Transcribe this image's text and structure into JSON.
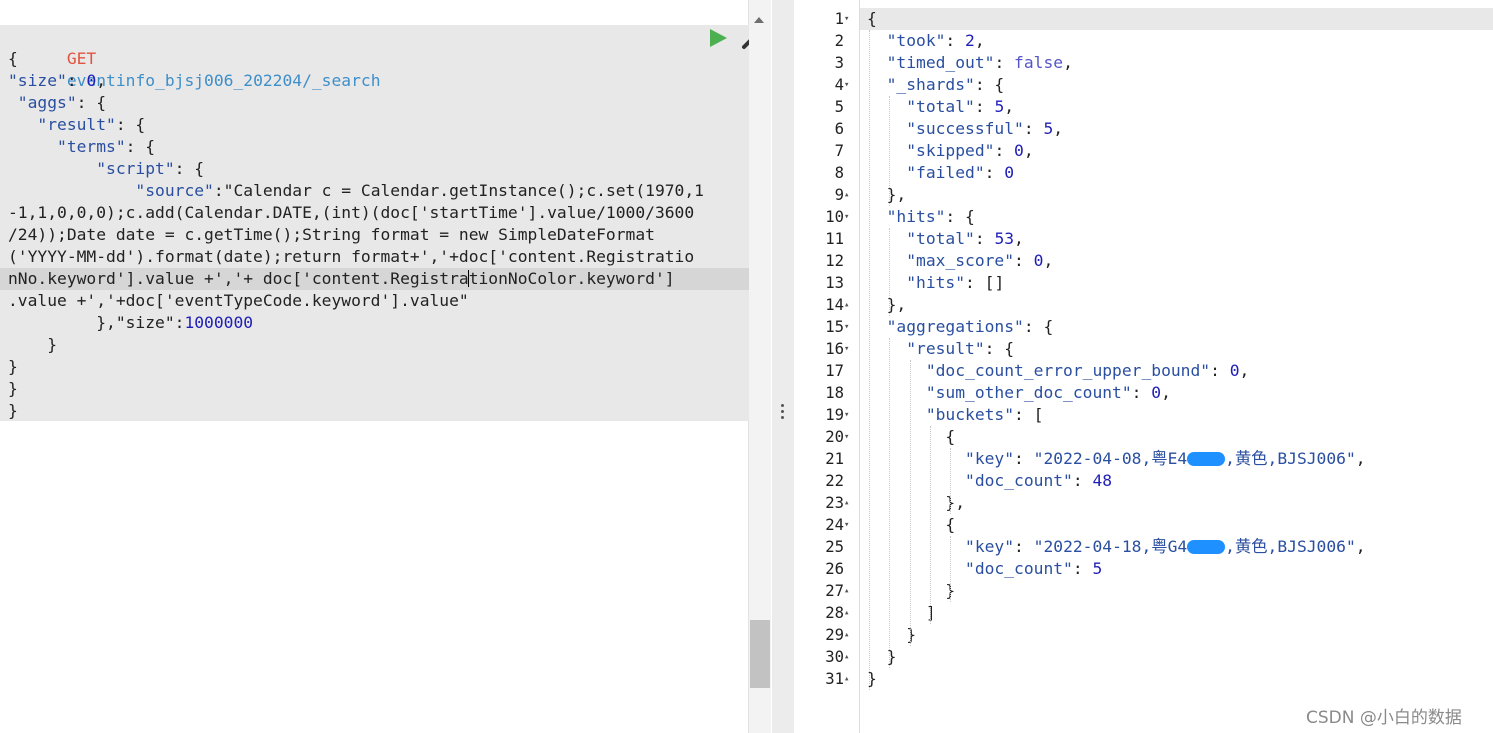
{
  "request": {
    "method": "GET",
    "url": "eventinfo_bjsj006_202204/_search",
    "run_label": "Run request",
    "settings_label": "Settings",
    "lines": [
      {
        "parts": [
          {
            "t": "{",
            "c": "plain"
          }
        ]
      },
      {
        "parts": [
          {
            "t": "\"size\"",
            "c": "key"
          },
          {
            "t": ": ",
            "c": "plain"
          },
          {
            "t": "0",
            "c": "num"
          },
          {
            "t": ",",
            "c": "plain"
          }
        ]
      },
      {
        "parts": [
          {
            "t": " \"aggs\"",
            "c": "key"
          },
          {
            "t": ": {",
            "c": "plain"
          }
        ]
      },
      {
        "parts": [
          {
            "t": "   \"result\"",
            "c": "key"
          },
          {
            "t": ": {",
            "c": "plain"
          }
        ]
      },
      {
        "parts": [
          {
            "t": "     \"terms\"",
            "c": "key"
          },
          {
            "t": ": {",
            "c": "plain"
          }
        ]
      },
      {
        "parts": [
          {
            "t": "         \"script\"",
            "c": "key"
          },
          {
            "t": ": {",
            "c": "plain"
          }
        ]
      },
      {
        "parts": [
          {
            "t": "             \"source\"",
            "c": "key"
          },
          {
            "t": ":\"Calendar c = Calendar.getInstance();c.set(1970,1",
            "c": "plain"
          }
        ]
      },
      {
        "parts": [
          {
            "t": "-1,1,0,0,0);c.add(Calendar.DATE,(int)(doc['startTime'].value/1000/3600",
            "c": "plain"
          }
        ]
      },
      {
        "parts": [
          {
            "t": "/24));Date date = c.getTime();String format = new SimpleDateFormat",
            "c": "plain"
          }
        ]
      },
      {
        "parts": [
          {
            "t": "('YYYY-MM-dd').format(date);return format+','+doc['content.Registratio",
            "c": "plain"
          }
        ]
      },
      {
        "parts": [
          {
            "t": "nNo.keyword'].value +','+ doc['content.Registra",
            "c": "plain"
          },
          {
            "t": "tionNoColor.keyword']",
            "c": "plain"
          }
        ],
        "current": true
      },
      {
        "parts": [
          {
            "t": ".value +','+doc['eventTypeCode.keyword'].value\"",
            "c": "plain"
          }
        ]
      },
      {
        "parts": [
          {
            "t": "         },\"size\"",
            "c": "plain"
          },
          {
            "t": ":",
            "c": "plain"
          },
          {
            "t": "1000000",
            "c": "num"
          }
        ]
      },
      {
        "parts": [
          {
            "t": "    }",
            "c": "plain"
          }
        ]
      },
      {
        "parts": [
          {
            "t": "}",
            "c": "plain"
          }
        ]
      },
      {
        "parts": [
          {
            "t": "}",
            "c": "plain"
          }
        ]
      },
      {
        "parts": [
          {
            "t": "}",
            "c": "plain"
          }
        ]
      }
    ]
  },
  "response": {
    "lines": [
      {
        "n": "1",
        "fold": "▾",
        "parts": [
          {
            "t": "{",
            "c": "plain"
          }
        ]
      },
      {
        "n": "2",
        "fold": "",
        "parts": [
          {
            "t": "  \"took\"",
            "c": "key"
          },
          {
            "t": ": ",
            "c": "plain"
          },
          {
            "t": "2",
            "c": "num"
          },
          {
            "t": ",",
            "c": "plain"
          }
        ]
      },
      {
        "n": "3",
        "fold": "",
        "parts": [
          {
            "t": "  \"timed_out\"",
            "c": "key"
          },
          {
            "t": ": ",
            "c": "plain"
          },
          {
            "t": "false",
            "c": "bool"
          },
          {
            "t": ",",
            "c": "plain"
          }
        ]
      },
      {
        "n": "4",
        "fold": "▾",
        "parts": [
          {
            "t": "  \"_shards\"",
            "c": "key"
          },
          {
            "t": ": {",
            "c": "plain"
          }
        ]
      },
      {
        "n": "5",
        "fold": "",
        "parts": [
          {
            "t": "    \"total\"",
            "c": "key"
          },
          {
            "t": ": ",
            "c": "plain"
          },
          {
            "t": "5",
            "c": "num"
          },
          {
            "t": ",",
            "c": "plain"
          }
        ]
      },
      {
        "n": "6",
        "fold": "",
        "parts": [
          {
            "t": "    \"successful\"",
            "c": "key"
          },
          {
            "t": ": ",
            "c": "plain"
          },
          {
            "t": "5",
            "c": "num"
          },
          {
            "t": ",",
            "c": "plain"
          }
        ]
      },
      {
        "n": "7",
        "fold": "",
        "parts": [
          {
            "t": "    \"skipped\"",
            "c": "key"
          },
          {
            "t": ": ",
            "c": "plain"
          },
          {
            "t": "0",
            "c": "num"
          },
          {
            "t": ",",
            "c": "plain"
          }
        ]
      },
      {
        "n": "8",
        "fold": "",
        "parts": [
          {
            "t": "    \"failed\"",
            "c": "key"
          },
          {
            "t": ": ",
            "c": "plain"
          },
          {
            "t": "0",
            "c": "num"
          }
        ]
      },
      {
        "n": "9",
        "fold": "▴",
        "parts": [
          {
            "t": "  },",
            "c": "plain"
          }
        ]
      },
      {
        "n": "10",
        "fold": "▾",
        "parts": [
          {
            "t": "  \"hits\"",
            "c": "key"
          },
          {
            "t": ": {",
            "c": "plain"
          }
        ]
      },
      {
        "n": "11",
        "fold": "",
        "parts": [
          {
            "t": "    \"total\"",
            "c": "key"
          },
          {
            "t": ": ",
            "c": "plain"
          },
          {
            "t": "53",
            "c": "num"
          },
          {
            "t": ",",
            "c": "plain"
          }
        ]
      },
      {
        "n": "12",
        "fold": "",
        "parts": [
          {
            "t": "    \"max_score\"",
            "c": "key"
          },
          {
            "t": ": ",
            "c": "plain"
          },
          {
            "t": "0",
            "c": "num"
          },
          {
            "t": ",",
            "c": "plain"
          }
        ]
      },
      {
        "n": "13",
        "fold": "",
        "parts": [
          {
            "t": "    \"hits\"",
            "c": "key"
          },
          {
            "t": ": []",
            "c": "plain"
          }
        ]
      },
      {
        "n": "14",
        "fold": "▴",
        "parts": [
          {
            "t": "  },",
            "c": "plain"
          }
        ]
      },
      {
        "n": "15",
        "fold": "▾",
        "parts": [
          {
            "t": "  \"aggregations\"",
            "c": "key"
          },
          {
            "t": ": {",
            "c": "plain"
          }
        ]
      },
      {
        "n": "16",
        "fold": "▾",
        "parts": [
          {
            "t": "    \"result\"",
            "c": "key"
          },
          {
            "t": ": {",
            "c": "plain"
          }
        ]
      },
      {
        "n": "17",
        "fold": "",
        "parts": [
          {
            "t": "      \"doc_count_error_upper_bound\"",
            "c": "key"
          },
          {
            "t": ": ",
            "c": "plain"
          },
          {
            "t": "0",
            "c": "num"
          },
          {
            "t": ",",
            "c": "plain"
          }
        ]
      },
      {
        "n": "18",
        "fold": "",
        "parts": [
          {
            "t": "      \"sum_other_doc_count\"",
            "c": "key"
          },
          {
            "t": ": ",
            "c": "plain"
          },
          {
            "t": "0",
            "c": "num"
          },
          {
            "t": ",",
            "c": "plain"
          }
        ]
      },
      {
        "n": "19",
        "fold": "▾",
        "parts": [
          {
            "t": "      \"buckets\"",
            "c": "key"
          },
          {
            "t": ": [",
            "c": "plain"
          }
        ]
      },
      {
        "n": "20",
        "fold": "▾",
        "parts": [
          {
            "t": "        {",
            "c": "plain"
          }
        ]
      },
      {
        "n": "21",
        "fold": "",
        "parts": [
          {
            "t": "          \"key\"",
            "c": "key"
          },
          {
            "t": ": ",
            "c": "plain"
          },
          {
            "t": "\"2022-04-08,粤E4",
            "c": "str"
          },
          {
            "t": "",
            "c": "redact"
          },
          {
            "t": ",黄色,BJSJ006\"",
            "c": "str"
          },
          {
            "t": ",",
            "c": "plain"
          }
        ]
      },
      {
        "n": "22",
        "fold": "",
        "parts": [
          {
            "t": "          \"doc_count\"",
            "c": "key"
          },
          {
            "t": ": ",
            "c": "plain"
          },
          {
            "t": "48",
            "c": "num"
          }
        ]
      },
      {
        "n": "23",
        "fold": "▴",
        "parts": [
          {
            "t": "        },",
            "c": "plain"
          }
        ]
      },
      {
        "n": "24",
        "fold": "▾",
        "parts": [
          {
            "t": "        {",
            "c": "plain"
          }
        ]
      },
      {
        "n": "25",
        "fold": "",
        "parts": [
          {
            "t": "          \"key\"",
            "c": "key"
          },
          {
            "t": ": ",
            "c": "plain"
          },
          {
            "t": "\"2022-04-18,粤G4",
            "c": "str"
          },
          {
            "t": "",
            "c": "redact"
          },
          {
            "t": ",黄色,BJSJ006\"",
            "c": "str"
          },
          {
            "t": ",",
            "c": "plain"
          }
        ]
      },
      {
        "n": "26",
        "fold": "",
        "parts": [
          {
            "t": "          \"doc_count\"",
            "c": "key"
          },
          {
            "t": ": ",
            "c": "plain"
          },
          {
            "t": "5",
            "c": "num"
          }
        ]
      },
      {
        "n": "27",
        "fold": "▴",
        "parts": [
          {
            "t": "        }",
            "c": "plain"
          }
        ]
      },
      {
        "n": "28",
        "fold": "▴",
        "parts": [
          {
            "t": "      ]",
            "c": "plain"
          }
        ]
      },
      {
        "n": "29",
        "fold": "▴",
        "parts": [
          {
            "t": "    }",
            "c": "plain"
          }
        ]
      },
      {
        "n": "30",
        "fold": "▴",
        "parts": [
          {
            "t": "  }",
            "c": "plain"
          }
        ]
      },
      {
        "n": "31",
        "fold": "▴",
        "parts": [
          {
            "t": "}",
            "c": "plain"
          }
        ]
      }
    ]
  },
  "watermark": "CSDN @小白的数据",
  "colors": {
    "method": "#e0543f",
    "url": "#3f8fc9",
    "run": "#4caf50",
    "redaction": "#1e90ff"
  }
}
